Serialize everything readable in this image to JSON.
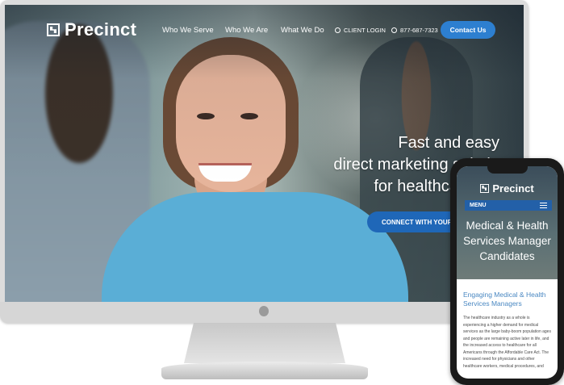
{
  "desktop": {
    "logo": {
      "icon": "qr-logo-icon",
      "text": "Precinct"
    },
    "nav": {
      "items": [
        "Who We Serve",
        "Who We Are",
        "What We Do"
      ],
      "client_login": "CLIENT LOGIN",
      "phone": "877-687-7323",
      "contact_button": "Contact Us"
    },
    "hero": {
      "line1": "Fast and easy",
      "line2": "direct marketing solutio",
      "line3": "for healthcare rec",
      "cta": "CONNECT WITH YOUR C"
    }
  },
  "mobile": {
    "logo_text": "Precinct",
    "menu_label": "MENU",
    "title": "Medical & Health Services Manager Candidates",
    "subtitle": "Engaging Medical & Health Services Managers",
    "body": "The healthcare industry as a whole is experiencing a higher demand for medical services as the large baby-boom population ages and people are remaining active later in life, and the increased access to healthcare for all Americans through the Affordable Care Act. The increased need for physicians and other healthcare workers, medical procedures, and"
  },
  "colors": {
    "accent": "#2d7fd0",
    "menu_bar": "#2360a8",
    "subtitle": "#4a88c2"
  }
}
